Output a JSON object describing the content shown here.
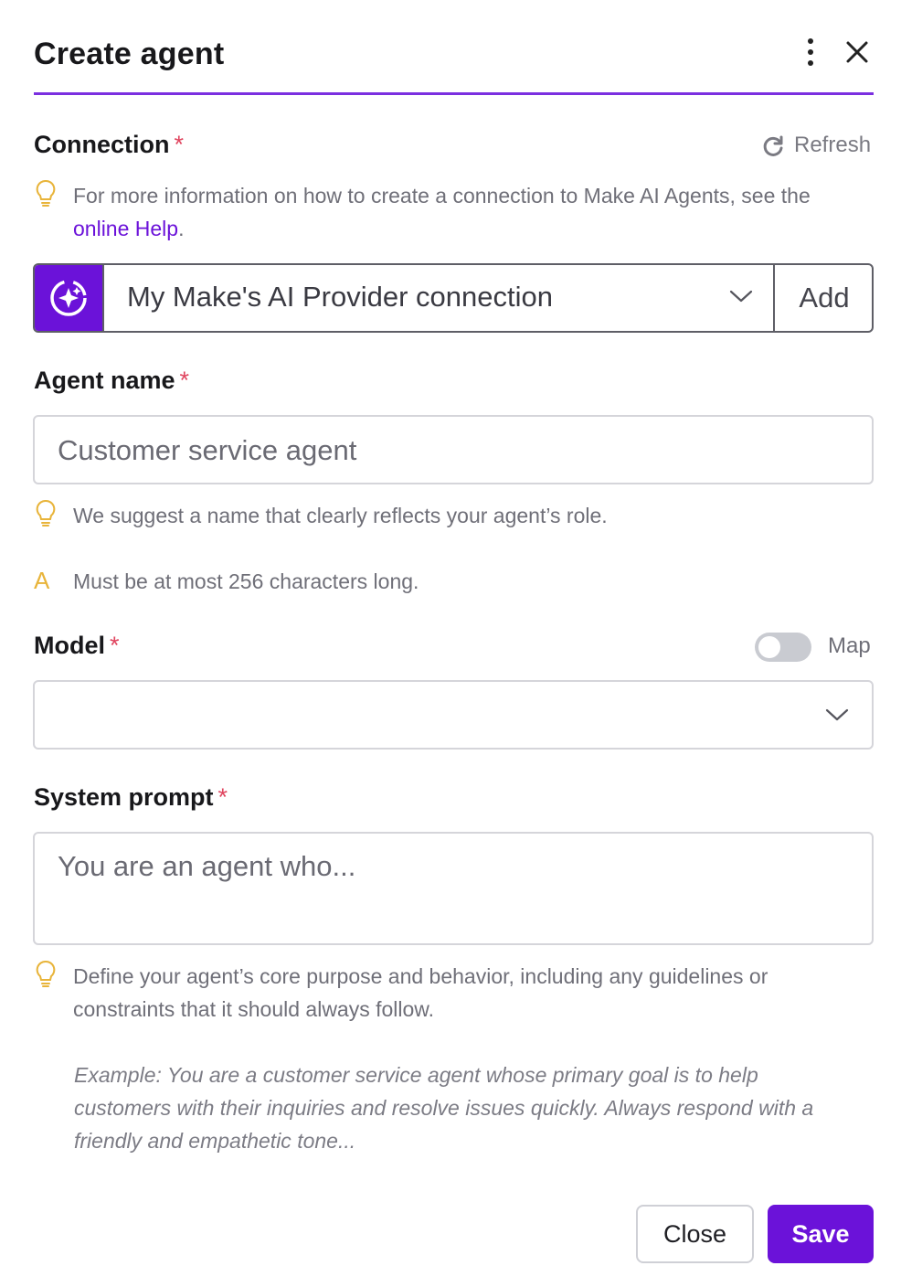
{
  "dialog": {
    "title": "Create agent",
    "accent_color": "#7b2fe0"
  },
  "connection": {
    "label": "Connection",
    "required_mark": "*",
    "refresh_label": "Refresh",
    "hint_prefix": "For more information on how to create a connection to Make AI Agents, see the",
    "hint_link": "online Help",
    "hint_suffix": ".",
    "selected": "My Make's AI Provider connection",
    "add_label": "Add",
    "icon": "ai-sparkle-icon"
  },
  "agent_name": {
    "label": "Agent name",
    "required_mark": "*",
    "placeholder": "Customer service agent",
    "hint": "We suggest a name that clearly reflects your agent’s role.",
    "warning_glyph": "A",
    "warning": "Must be at most 256 characters long."
  },
  "model": {
    "label": "Model",
    "required_mark": "*",
    "map_label": "Map",
    "map_enabled": false,
    "selected": ""
  },
  "system_prompt": {
    "label": "System prompt",
    "required_mark": "*",
    "placeholder": "You are an agent who...",
    "hint": "Define your agent’s core purpose and behavior, including any guidelines or constraints that it should always follow.",
    "example": "Example: You are a customer service agent whose primary goal is to help customers with their inquiries and resolve issues quickly. Always respond with a friendly and empathetic tone..."
  },
  "footer": {
    "close_label": "Close",
    "save_label": "Save",
    "save_color": "#6b12d9"
  }
}
